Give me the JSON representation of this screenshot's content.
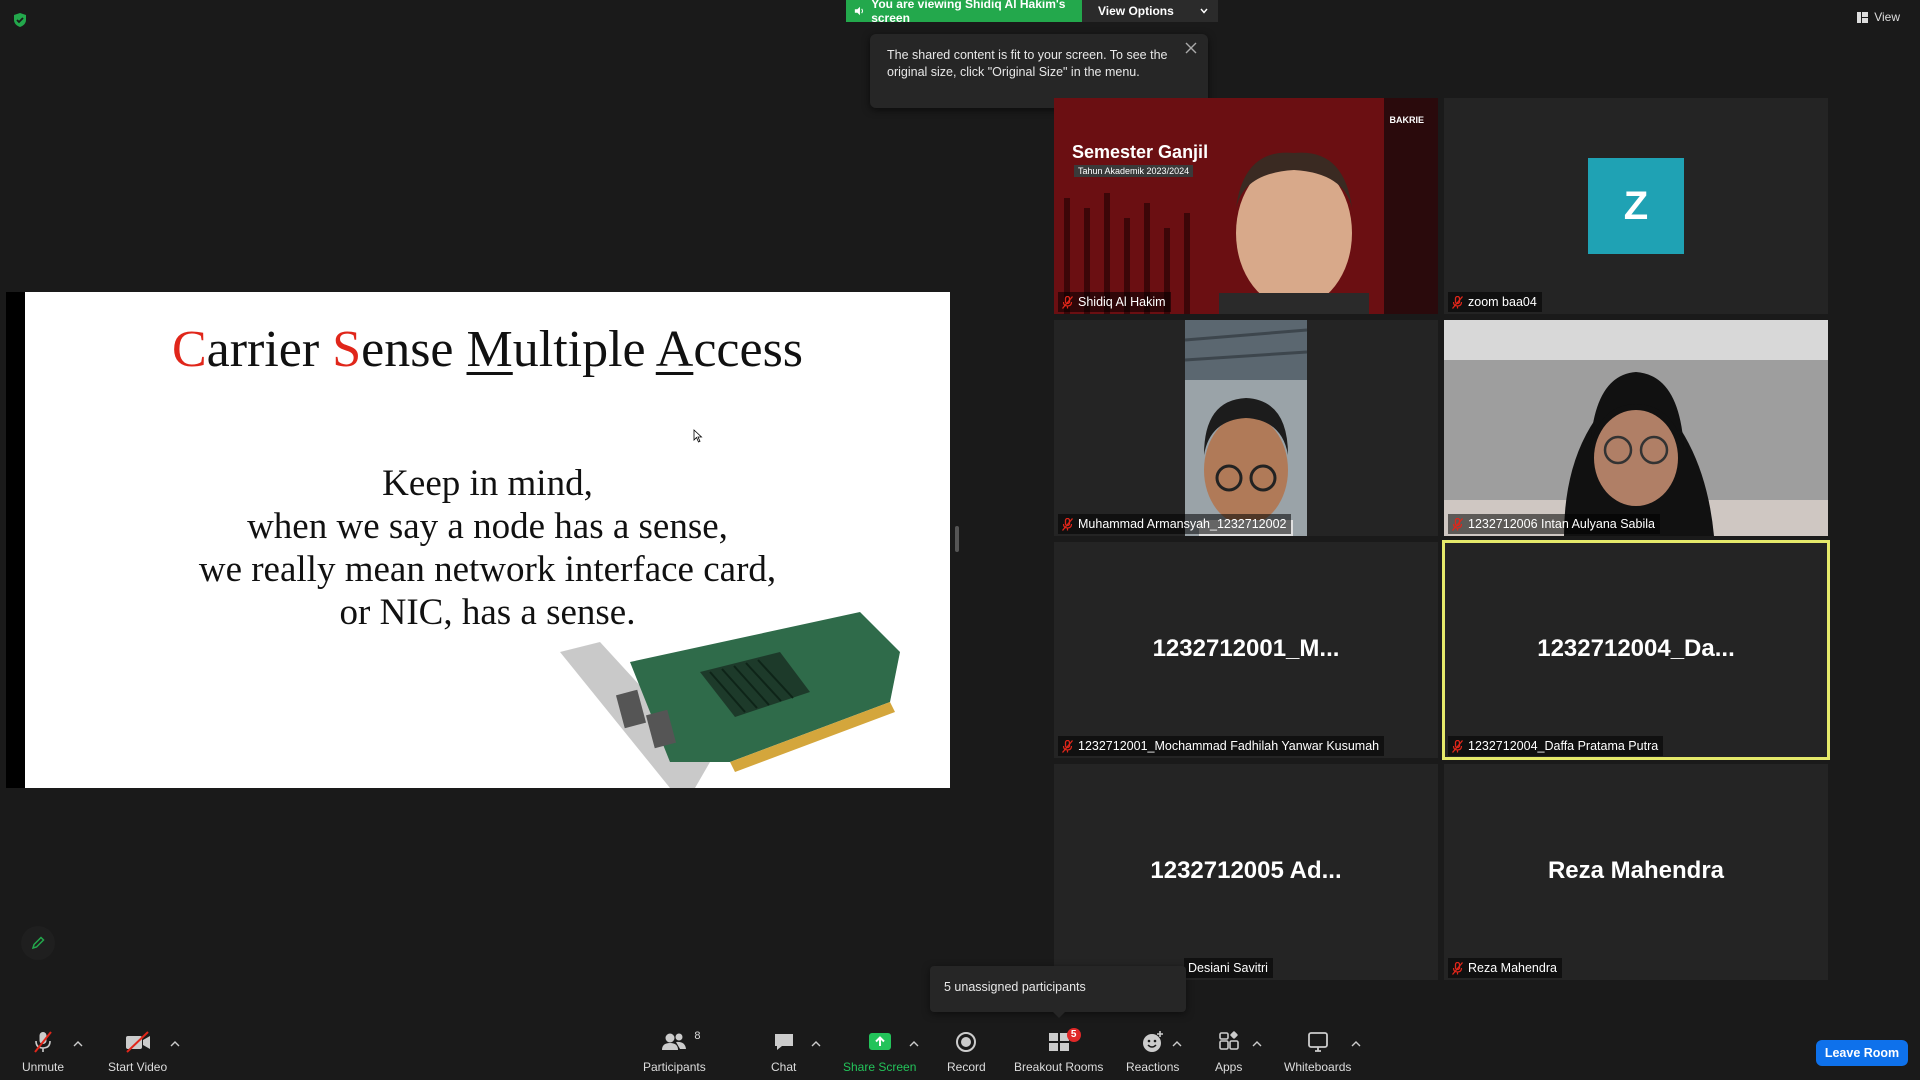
{
  "banner": {
    "status": "You are viewing Shidiq Al Hakim's screen",
    "view_options": "View Options"
  },
  "view_button": "View",
  "tooltip": {
    "text": "The shared content is fit to your screen. To see the original size, click \"Original Size\" in the menu."
  },
  "slide": {
    "title_parts": [
      "C",
      "arrier ",
      "S",
      "ense ",
      "M",
      "ultiple ",
      "A",
      "ccess"
    ],
    "body_lines": [
      "Keep in mind,",
      "when we say a node has a sense,",
      "we really mean network interface card,",
      "or NIC, has a sense."
    ]
  },
  "tiles": [
    {
      "name": "Shidiq Al Hakim",
      "muted": true,
      "video": "Semester Ganjil",
      "video_sub": "Tahun Akademik 2023/2024",
      "logo": "BAKRIE"
    },
    {
      "name": "zoom baa04",
      "muted": true,
      "avatar_letter": "Z"
    },
    {
      "name": "Muhammad Armansyah_1232712002",
      "muted": true
    },
    {
      "name": "1232712006 Intan Aulyana Sabila",
      "muted": true
    },
    {
      "name": "1232712001_Mochammad Fadhilah Yanwar Kusumah",
      "muted": true,
      "display": "1232712001_M..."
    },
    {
      "name": "1232712004_Daffa Pratama Putra",
      "muted": true,
      "display": "1232712004_Da...",
      "active_speaker": true
    },
    {
      "name": "Desiani Savitri",
      "muted": false,
      "display": "1232712005  Ad..."
    },
    {
      "name": "Reza Mahendra",
      "muted": true,
      "display": "Reza Mahendra"
    }
  ],
  "notice": "5 unassigned participants",
  "toolbar": {
    "unmute": "Unmute",
    "start_video": "Start Video",
    "participants": "Participants",
    "participants_count": "8",
    "chat": "Chat",
    "share_screen": "Share Screen",
    "record": "Record",
    "breakout_rooms": "Breakout Rooms",
    "breakout_badge": "5",
    "reactions": "Reactions",
    "apps": "Apps",
    "whiteboards": "Whiteboards",
    "leave": "Leave Room"
  },
  "colors": {
    "active_speaker": "#e5e96a",
    "share_green": "#23a84c",
    "leave_blue": "#0e71eb",
    "avatar_teal": "#1fa2b4",
    "mute_red": "#e0261a"
  }
}
